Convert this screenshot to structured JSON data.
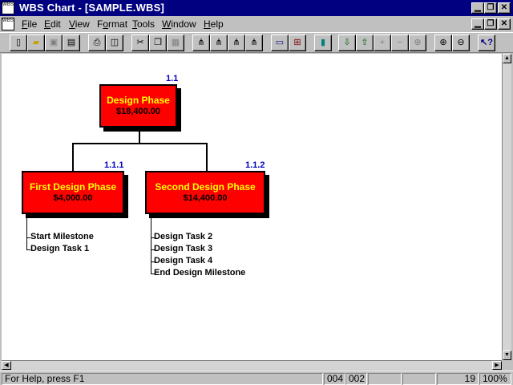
{
  "window": {
    "title": "WBS Chart - [SAMPLE.WBS]",
    "app_icon_text": "WBS",
    "doc_icon_text": "WBS"
  },
  "menu": [
    {
      "ul": "F",
      "rest": "ile"
    },
    {
      "ul": "E",
      "rest": "dit"
    },
    {
      "ul": "V",
      "rest": "iew"
    },
    {
      "pre": "F",
      "ul": "o",
      "rest": "rmat"
    },
    {
      "ul": "T",
      "rest": "ools"
    },
    {
      "ul": "W",
      "rest": "indow"
    },
    {
      "ul": "H",
      "rest": "elp"
    }
  ],
  "toolbar_icons": [
    "new-file",
    "open-folder",
    "save",
    "save-as",
    "print",
    "print-preview",
    "cut",
    "copy",
    "paste",
    "layout-1",
    "layout-2",
    "layout-3",
    "layout-4",
    "view-box",
    "view-tree",
    "task-properties",
    "move-down",
    "move-up",
    "add",
    "remove",
    "add-sub",
    "zoom-in",
    "zoom-out",
    "context-help"
  ],
  "chart": {
    "root": {
      "id": "1.1",
      "name": "Design Phase",
      "cost": "$18,400.00"
    },
    "children": [
      {
        "id": "1.1.1",
        "name": "First Design Phase",
        "cost": "$4,000.00",
        "tasks": [
          "Start Milestone",
          "Design Task 1"
        ]
      },
      {
        "id": "1.1.2",
        "name": "Second Design Phase",
        "cost": "$14,400.00",
        "tasks": [
          "Design Task 2",
          "Design Task 3",
          "Design Task 4",
          "End Design Milestone"
        ]
      }
    ]
  },
  "status": {
    "help": "For Help, press F1",
    "col1": "004",
    "col2": "002",
    "count": "19",
    "zoom": "100%"
  },
  "colors": {
    "node_fill": "#ff0000",
    "node_title": "#ffff00",
    "node_id": "#0000c0",
    "title_bar": "#000080"
  }
}
